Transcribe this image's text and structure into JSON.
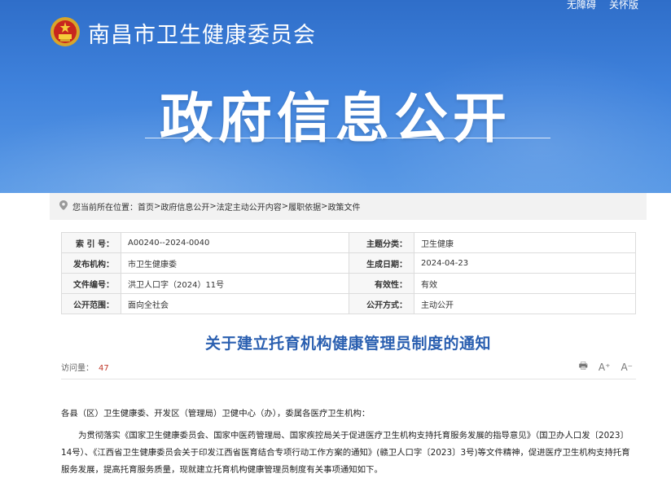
{
  "header": {
    "site_name": "南昌市卫生健康委员会",
    "links": [
      "无障碍",
      "关怀版"
    ],
    "banner_title": "政府信息公开"
  },
  "breadcrumb": {
    "prefix": "您当前所在位置：",
    "items": [
      "首页",
      "政府信息公开",
      "法定主动公开内容",
      "履职依据",
      "政策文件"
    ],
    "separator": ">"
  },
  "info_table": [
    {
      "k1": "索 引 号：",
      "v1": "A00240--2024-0040",
      "k2": "主题分类：",
      "v2": "卫生健康"
    },
    {
      "k1": "发布机构：",
      "v1": "市卫生健康委",
      "k2": "生成日期：",
      "v2": "2024-04-23"
    },
    {
      "k1": "文件编号：",
      "v1": "洪卫人口字（2024）11号",
      "k2": "有效性：",
      "v2": "有效"
    },
    {
      "k1": "公开范围：",
      "v1": "面向全社会",
      "k2": "公开方式：",
      "v2": "主动公开"
    }
  ],
  "document": {
    "title": "关于建立托育机构健康管理员制度的通知",
    "visits_label": "访问量：",
    "visits_count": "47",
    "tools": {
      "print": "🖶",
      "font_up": "A⁺",
      "font_down": "A⁻"
    },
    "salutation": "各县（区）卫生健康委、开发区（管理局）卫健中心（办），委属各医疗卫生机构：",
    "paragraph1": "为贯彻落实《国家卫生健康委员会、国家中医药管理局、国家疾控局关于促进医疗卫生机构支持托育服务发展的指导意见》（国卫办人口发〔2023〕14号）、《江西省卫生健康委员会关于印发江西省医育结合专项行动工作方案的通知》(赣卫人口字〔2023〕3号)等文件精神，促进医疗卫生机构支持托育服务发展，提高托育服务质量，现就建立托育机构健康管理员制度有关事项通知如下。"
  },
  "colors": {
    "banner_top": "#2f6ec9",
    "banner_bottom": "#5a9ae6",
    "title_blue": "#2a5fb0",
    "visit_count_red": "#c0392b"
  }
}
